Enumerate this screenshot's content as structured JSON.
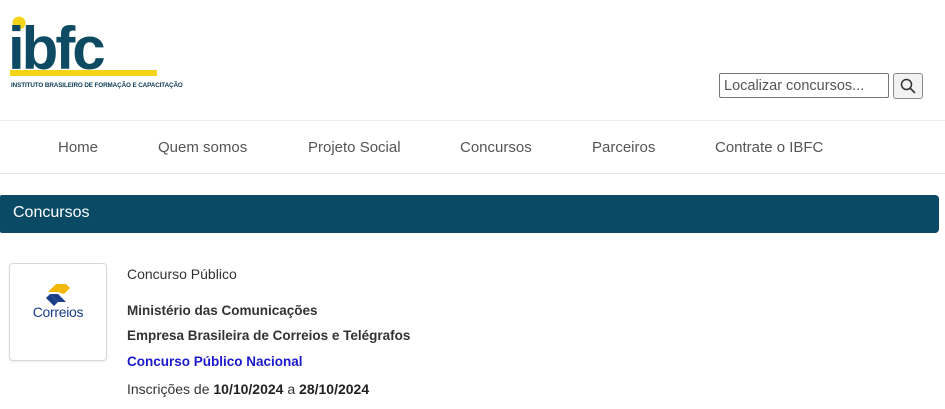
{
  "header": {
    "logo_text": "ibfc",
    "logo_subtitle": "INSTITUTO BRASILEIRO DE FORMAÇÃO E CAPACITAÇÃO",
    "search_placeholder": "Localizar concursos...",
    "search_icon": "search-icon"
  },
  "nav": {
    "items": [
      {
        "label": "Home"
      },
      {
        "label": "Quem somos"
      },
      {
        "label": "Projeto Social"
      },
      {
        "label": "Concursos"
      },
      {
        "label": "Parceiros"
      },
      {
        "label": "Contrate o IBFC"
      }
    ]
  },
  "section": {
    "title": "Concursos"
  },
  "listing": {
    "logo_label": "Correios",
    "type": "Concurso Público",
    "organization": "Ministério das Comunicações",
    "entity": "Empresa Brasileira de Correios e Telégrafos",
    "link_text": "Concurso Público Nacional",
    "inscricoes_prefix": "Inscrições de",
    "inscricoes_start": "10/10/2024",
    "inscricoes_sep": "a",
    "inscricoes_end": "28/10/2024"
  },
  "colors": {
    "brand_dark": "#0b4a65",
    "brand_yellow": "#f5d417",
    "link": "#1a1acc"
  }
}
